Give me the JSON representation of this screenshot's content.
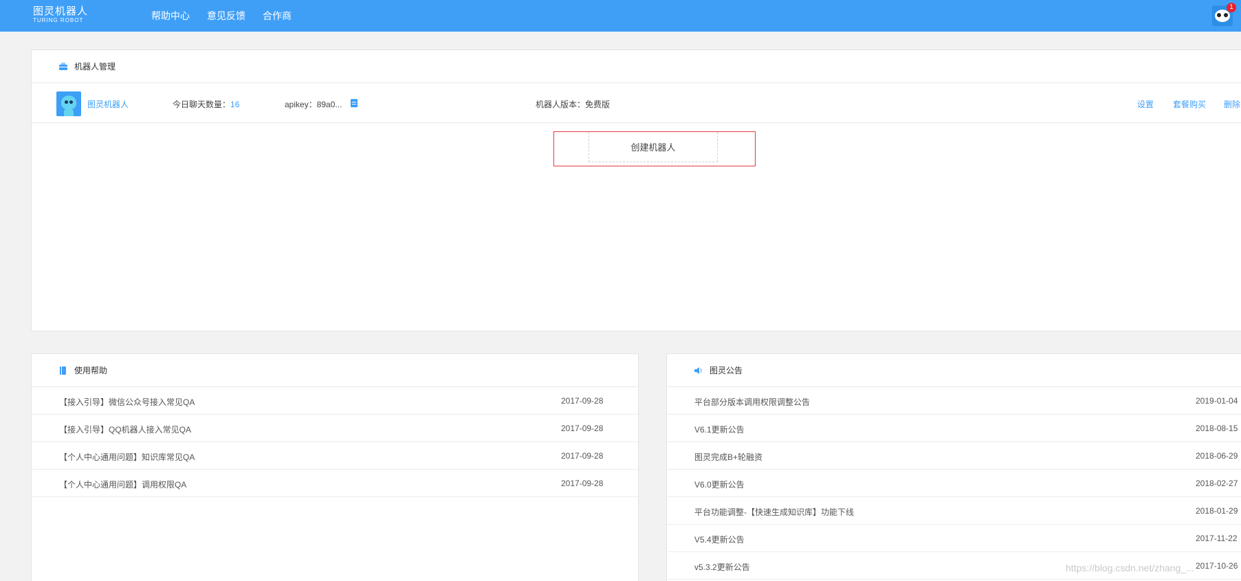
{
  "header": {
    "logo_cn": "图灵机器人",
    "logo_en": "TURING ROBOT",
    "nav": [
      "帮助中心",
      "意见反馈",
      "合作商"
    ],
    "badge_count": "1"
  },
  "robot_panel": {
    "title": "机器人管理",
    "robot": {
      "name": "图灵机器人",
      "chat_label": "今日聊天数量：",
      "chat_count": "16",
      "apikey": "apikey：89a0...",
      "version": "机器人版本：免费版",
      "actions": [
        "设置",
        "套餐购买",
        "删除"
      ]
    },
    "create_label": "创建机器人"
  },
  "help_panel": {
    "title": "使用帮助",
    "items": [
      {
        "title": "【接入引导】微信公众号接入常见QA",
        "date": "2017-09-28"
      },
      {
        "title": "【接入引导】QQ机器人接入常见QA",
        "date": "2017-09-28"
      },
      {
        "title": "【个人中心通用问题】知识库常见QA",
        "date": "2017-09-28"
      },
      {
        "title": "【个人中心通用问题】调用权限QA",
        "date": "2017-09-28"
      }
    ]
  },
  "notice_panel": {
    "title": "图灵公告",
    "items": [
      {
        "title": "平台部分版本调用权限调整公告",
        "date": "2019-01-04"
      },
      {
        "title": "V6.1更新公告",
        "date": "2018-08-15"
      },
      {
        "title": "图灵完成B+轮融资",
        "date": "2018-06-29"
      },
      {
        "title": "V6.0更新公告",
        "date": "2018-02-27"
      },
      {
        "title": "平台功能调整-【快速生成知识库】功能下线",
        "date": "2018-01-29"
      },
      {
        "title": "V5.4更新公告",
        "date": "2017-11-22"
      },
      {
        "title": "v5.3.2更新公告",
        "date": "2017-10-26"
      }
    ]
  },
  "watermark": "https://blog.csdn.net/zhang_..."
}
